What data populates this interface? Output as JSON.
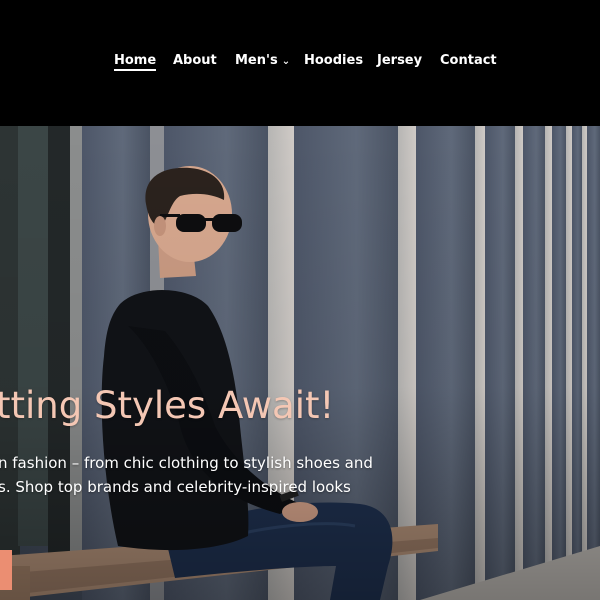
{
  "nav": {
    "items": [
      {
        "label": "Home",
        "active": true
      },
      {
        "label": "About"
      },
      {
        "label": "Men's",
        "has_dropdown": true,
        "icon": "chevron-down-icon"
      },
      {
        "label": "Hoodies"
      },
      {
        "label": "Jersey"
      },
      {
        "label": "Contact"
      }
    ]
  },
  "hero": {
    "title": "tting Styles Await!",
    "description_line1": "n fashion – from chic clothing to stylish shoes and",
    "description_line2": "s. Shop top brands and celebrity-inspired looks"
  },
  "colors": {
    "nav_bg": "#000000",
    "title": "#f4c7b4",
    "cta": "#eb8e72"
  }
}
